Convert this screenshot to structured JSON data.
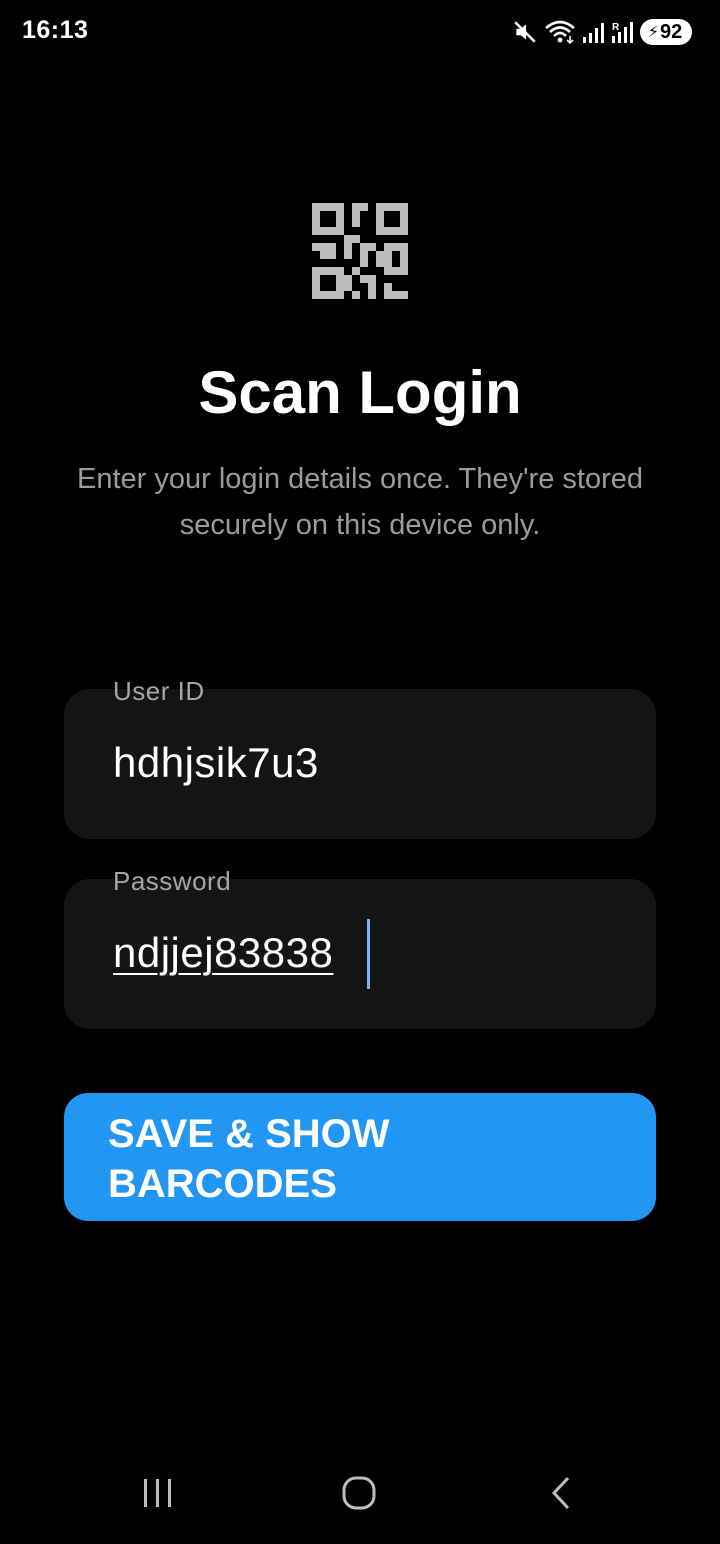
{
  "status_bar": {
    "time": "16:13",
    "battery_level": "92",
    "icons": [
      "mute-icon",
      "wifi-icon",
      "signal-icon",
      "signal-roaming-icon",
      "battery-charging-icon"
    ]
  },
  "header": {
    "icon": "qr-code-icon",
    "title": "Scan Login",
    "subtitle": "Enter your login details once. They're stored securely on this device only."
  },
  "form": {
    "user_id": {
      "label": "User ID",
      "value": "hdhjsik7u3"
    },
    "password": {
      "label": "Password",
      "value": "ndjjej83838"
    }
  },
  "actions": {
    "save_label": "SAVE & SHOW BARCODES"
  },
  "nav_bar": {
    "icons": [
      "recent-apps-icon",
      "home-icon",
      "back-icon"
    ]
  },
  "colors": {
    "background": "#000000",
    "field_background": "#141414",
    "accent": "#2196f3",
    "caret": "#7ab2ff",
    "muted_text": "#9b9b9b"
  }
}
